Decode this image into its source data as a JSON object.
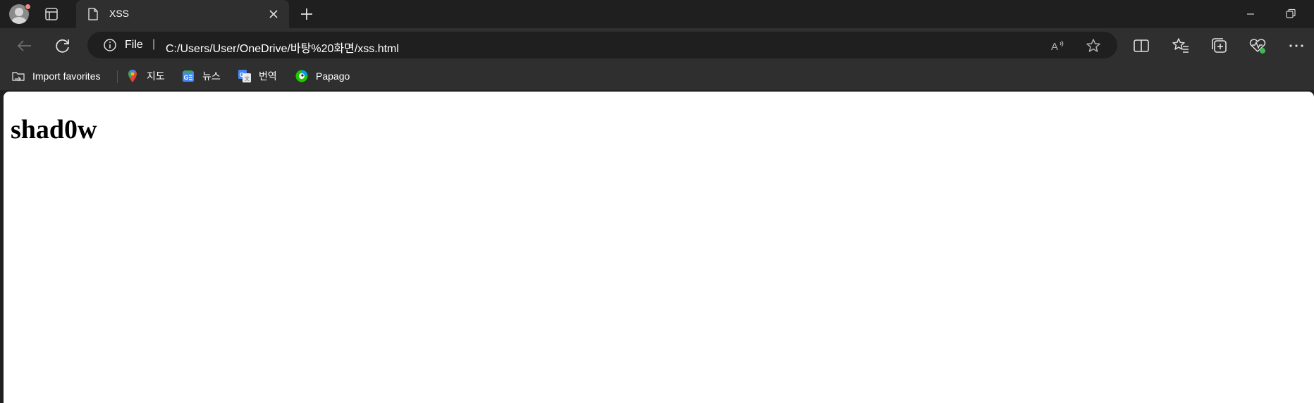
{
  "tab": {
    "title": "XSS"
  },
  "address_bar": {
    "scheme_label": "File",
    "separator": "|",
    "url": "C:/Users/User/OneDrive/바탕%20화면/xss.html"
  },
  "bookmarks": [
    {
      "label": "Import favorites",
      "icon": "import-favorites-icon"
    },
    {
      "label": "지도",
      "icon": "maps-icon"
    },
    {
      "label": "뉴스",
      "icon": "news-icon"
    },
    {
      "label": "번역",
      "icon": "translate-icon"
    },
    {
      "label": "Papago",
      "icon": "papago-icon"
    }
  ],
  "page": {
    "heading": "shad0w"
  },
  "colors": {
    "frame": "#1f1f1f",
    "toolbar": "#2f2f2f",
    "page_bg": "#ffffff",
    "profile_badge": "#f28b82",
    "health_badge": "#3fb950"
  }
}
